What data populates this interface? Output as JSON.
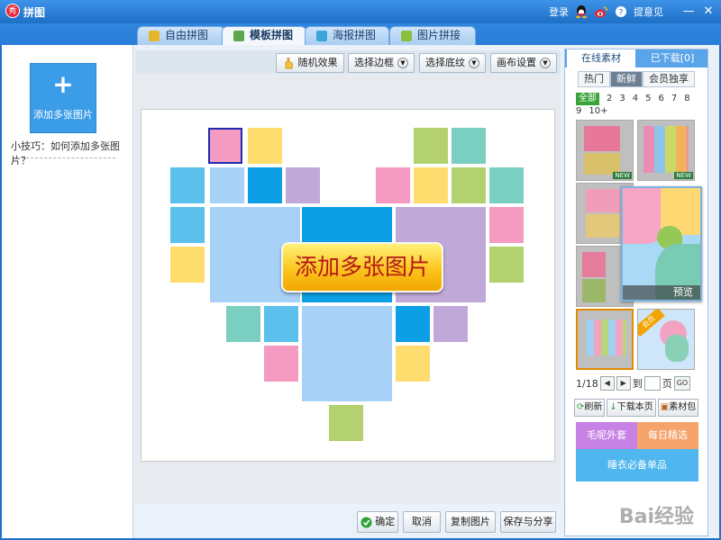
{
  "titlebar": {
    "logo_text": "秀",
    "title": "拼图",
    "login": "登录",
    "feedback": "提意见"
  },
  "tabs": [
    {
      "label": "自由拼图",
      "icon_color": "#e7b52c"
    },
    {
      "label": "模板拼图",
      "icon_color": "#5ea64b"
    },
    {
      "label": "海报拼图",
      "icon_color": "#3aa6d8"
    },
    {
      "label": "图片拼接",
      "icon_color": "#8ac03d"
    }
  ],
  "left": {
    "add_label": "添加多张图片",
    "tip": "小技巧：如何添加多张图片？"
  },
  "toolbar": {
    "random": "随机效果",
    "border": "选择边框",
    "pattern": "选择底纹",
    "canvas": "画布设置"
  },
  "canvas": {
    "center_label": "添加多张图片",
    "cells": [
      {
        "c": "#f59ac0",
        "sel": true
      },
      {
        "c": "#fedc6e"
      },
      {
        "c": "#b3d16e"
      },
      {
        "c": "#7acfc0"
      },
      {
        "c": "#5bc0ec"
      },
      {
        "c": "#a7d1f7"
      },
      {
        "c": "#0d9fe6"
      },
      {
        "c": "#c0a8d8"
      },
      {
        "c": "#f59ac0"
      },
      {
        "c": "#fedc6e"
      },
      {
        "c": "#b3d16e"
      },
      {
        "c": "#7acfc0"
      },
      {
        "c": "#5bc0ec"
      },
      {
        "c": "#f59ac0"
      },
      {
        "c": "#fedc6e"
      },
      {
        "c": "#b3d16e"
      },
      {
        "c": "#a7d1f7"
      },
      {
        "c": "#0d9fe6"
      },
      {
        "c": "#c0a8d8"
      },
      {
        "c": "#7acfc0"
      },
      {
        "c": "#5bc0ec"
      },
      {
        "c": "#0d9fe6"
      },
      {
        "c": "#c0a8d8"
      },
      {
        "c": "#f59ac0"
      },
      {
        "c": "#a7d1f7"
      },
      {
        "c": "#fedc6e"
      },
      {
        "c": "#b3d16e"
      }
    ]
  },
  "bottom": {
    "ok": "确定",
    "cancel": "取消",
    "copy": "复制图片",
    "save": "保存与分享"
  },
  "right": {
    "tab_online": "在线素材",
    "tab_downloaded": "已下载[0]",
    "sub_hot": "热门",
    "sub_new": "新鲜",
    "sub_vip": "会员独享",
    "filters": [
      "全部",
      "2",
      "3",
      "4",
      "5",
      "6",
      "7",
      "8",
      "9",
      "10+"
    ],
    "new_badge": "NEW",
    "vip_badge": "会员",
    "preview_label": "预览",
    "page_text": "1/18",
    "goto_text": "到",
    "page_unit": "页",
    "go": "GO",
    "refresh": "刷新",
    "download_page": "下载本页",
    "material_pack": "素材包",
    "ad1": "毛呢外套",
    "ad2": "每日精选",
    "ad3": "睡衣必备单品"
  },
  "watermark": "Bai经验"
}
